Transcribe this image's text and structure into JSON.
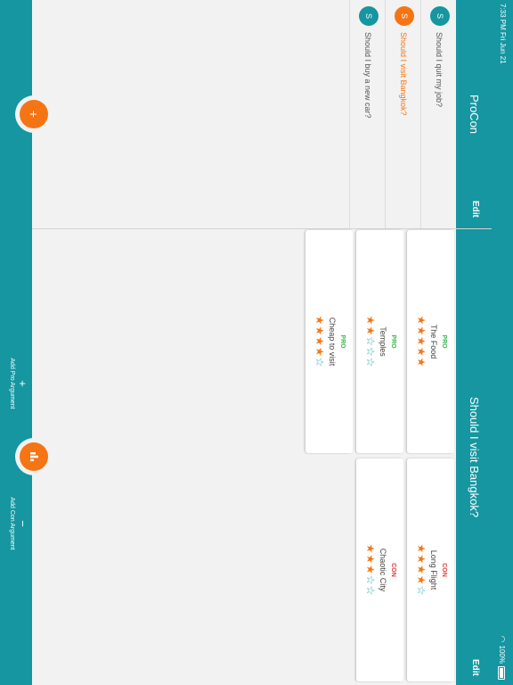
{
  "status_bar": {
    "time": "7:33 PM  Fri Jun 21",
    "battery": "100%",
    "wifi_icon": "wifi-icon",
    "battery_icon": "battery-icon"
  },
  "left_nav": {
    "title": "ProCon",
    "edit_label": "Edit"
  },
  "right_nav": {
    "title": "Should I visit Bangkok?",
    "edit_label": "Edit"
  },
  "questions": [
    {
      "initial": "S",
      "text": "Should I quit my job?",
      "selected": false
    },
    {
      "initial": "S",
      "text": "Should I visit Bangkok?",
      "selected": true
    },
    {
      "initial": "S",
      "text": "Should I buy a new car?",
      "selected": false
    }
  ],
  "add_question_fab": {
    "label": "+",
    "color": "#f57515"
  },
  "arguments": {
    "pros": [
      {
        "type": "PRO",
        "title": "The Food",
        "rating": 5,
        "max": 5
      },
      {
        "type": "PRO",
        "title": "Temples",
        "rating": 2,
        "max": 5
      },
      {
        "type": "PRO",
        "title": "Cheap to visit",
        "rating": 4,
        "max": 5
      }
    ],
    "cons": [
      {
        "type": "CON",
        "title": "Long Flight",
        "rating": 4,
        "max": 5
      },
      {
        "type": "CON",
        "title": "Chaotic City",
        "rating": 3,
        "max": 5
      }
    ]
  },
  "bottom_bar": {
    "add_pro": {
      "glyph": "+",
      "label": "Add Pro Argument"
    },
    "add_con": {
      "glyph": "−",
      "label": "Add Con Argument"
    }
  },
  "chart_fab": {
    "icon": "bar-chart-icon",
    "glyph": "▮▮▮"
  },
  "colors": {
    "primary": "#1596a1",
    "accent": "#f57515",
    "pro": "#39b54a",
    "con": "#e53935"
  }
}
